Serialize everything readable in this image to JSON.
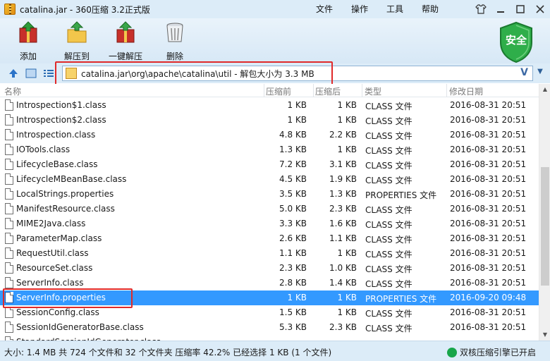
{
  "window": {
    "title": "catalina.jar - 360压缩 3.2正式版",
    "menu": [
      "文件",
      "操作",
      "工具",
      "帮助"
    ]
  },
  "toolbar": {
    "add": "添加",
    "extract": "解压到",
    "one_click": "一键解压",
    "delete": "删除",
    "badge": "安全"
  },
  "address": {
    "path": "catalina.jar\\org\\apache\\catalina\\util - 解包大小为 3.3 MB",
    "toggle": "V"
  },
  "columns": {
    "name": "名称",
    "size": "压缩前",
    "packed": "压缩后",
    "type": "类型",
    "modified": "修改日期"
  },
  "files": [
    {
      "name": "Introspection$1.class",
      "size": "1 KB",
      "packed": "1 KB",
      "type": "CLASS 文件",
      "modified": "2016-08-31 20:51"
    },
    {
      "name": "Introspection$2.class",
      "size": "1 KB",
      "packed": "1 KB",
      "type": "CLASS 文件",
      "modified": "2016-08-31 20:51"
    },
    {
      "name": "Introspection.class",
      "size": "4.8 KB",
      "packed": "2.2 KB",
      "type": "CLASS 文件",
      "modified": "2016-08-31 20:51"
    },
    {
      "name": "IOTools.class",
      "size": "1.3 KB",
      "packed": "1 KB",
      "type": "CLASS 文件",
      "modified": "2016-08-31 20:51"
    },
    {
      "name": "LifecycleBase.class",
      "size": "7.2 KB",
      "packed": "3.1 KB",
      "type": "CLASS 文件",
      "modified": "2016-08-31 20:51"
    },
    {
      "name": "LifecycleMBeanBase.class",
      "size": "4.5 KB",
      "packed": "1.9 KB",
      "type": "CLASS 文件",
      "modified": "2016-08-31 20:51"
    },
    {
      "name": "LocalStrings.properties",
      "size": "3.5 KB",
      "packed": "1.3 KB",
      "type": "PROPERTIES 文件",
      "modified": "2016-08-31 20:51"
    },
    {
      "name": "ManifestResource.class",
      "size": "5.0 KB",
      "packed": "2.3 KB",
      "type": "CLASS 文件",
      "modified": "2016-08-31 20:51"
    },
    {
      "name": "MIME2Java.class",
      "size": "3.3 KB",
      "packed": "1.6 KB",
      "type": "CLASS 文件",
      "modified": "2016-08-31 20:51"
    },
    {
      "name": "ParameterMap.class",
      "size": "2.6 KB",
      "packed": "1.1 KB",
      "type": "CLASS 文件",
      "modified": "2016-08-31 20:51"
    },
    {
      "name": "RequestUtil.class",
      "size": "1.1 KB",
      "packed": "1 KB",
      "type": "CLASS 文件",
      "modified": "2016-08-31 20:51"
    },
    {
      "name": "ResourceSet.class",
      "size": "2.3 KB",
      "packed": "1.0 KB",
      "type": "CLASS 文件",
      "modified": "2016-08-31 20:51"
    },
    {
      "name": "ServerInfo.class",
      "size": "2.8 KB",
      "packed": "1.4 KB",
      "type": "CLASS 文件",
      "modified": "2016-08-31 20:51"
    },
    {
      "name": "ServerInfo.properties",
      "size": "1 KB",
      "packed": "1 KB",
      "type": "PROPERTIES 文件",
      "modified": "2016-09-20 09:48",
      "selected": true
    },
    {
      "name": "SessionConfig.class",
      "size": "1.5 KB",
      "packed": "1 KB",
      "type": "CLASS 文件",
      "modified": "2016-08-31 20:51"
    },
    {
      "name": "SessionIdGeneratorBase.class",
      "size": "5.3 KB",
      "packed": "2.3 KB",
      "type": "CLASS 文件",
      "modified": "2016-08-31 20:51"
    },
    {
      "name": "StandardSessionIdGenerator.class",
      "size": "",
      "packed": "",
      "type": "",
      "modified": ""
    }
  ],
  "status": {
    "text": "大小: 1.4 MB 共 724 个文件和 32 个文件夹 压缩率 42.2% 已经选择 1 KB (1 个文件)",
    "engine": "双核压缩引擎已开启"
  },
  "colors": {
    "selection": "#3399ff",
    "highlight_box": "#e02a2a",
    "shield": "#2fae4a"
  }
}
